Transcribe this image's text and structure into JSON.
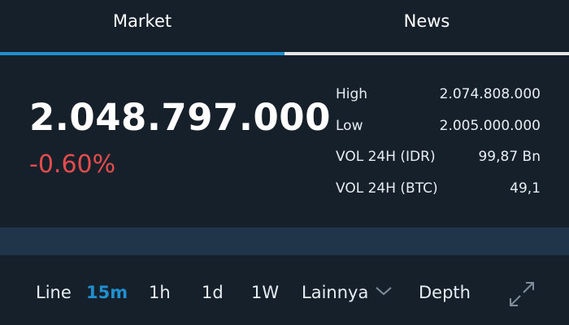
{
  "tabs": [
    {
      "label": "Market",
      "active": true
    },
    {
      "label": "News",
      "active": false
    }
  ],
  "price": {
    "last": "2.048.797.000",
    "change": "-0.60%"
  },
  "stats": [
    {
      "label": "High",
      "value": "2.074.808.000"
    },
    {
      "label": "Low",
      "value": "2.005.000.000"
    },
    {
      "label": "VOL 24H (IDR)",
      "value": "99,87 Bn"
    },
    {
      "label": "VOL 24H (BTC)",
      "value": "49,1"
    }
  ],
  "toolbar": {
    "line": "Line",
    "m15": "15m",
    "h1": "1h",
    "d1": "1d",
    "w1": "1W",
    "more": "Lainnya",
    "depth": "Depth",
    "active": "15m"
  },
  "icons": {
    "dropdown": "chevron-down-icon",
    "fullscreen": "expand-icon"
  },
  "colors": {
    "background": "#15202b",
    "accent": "#1f8fd0",
    "negative": "#e74c4c",
    "band": "#20344a"
  }
}
